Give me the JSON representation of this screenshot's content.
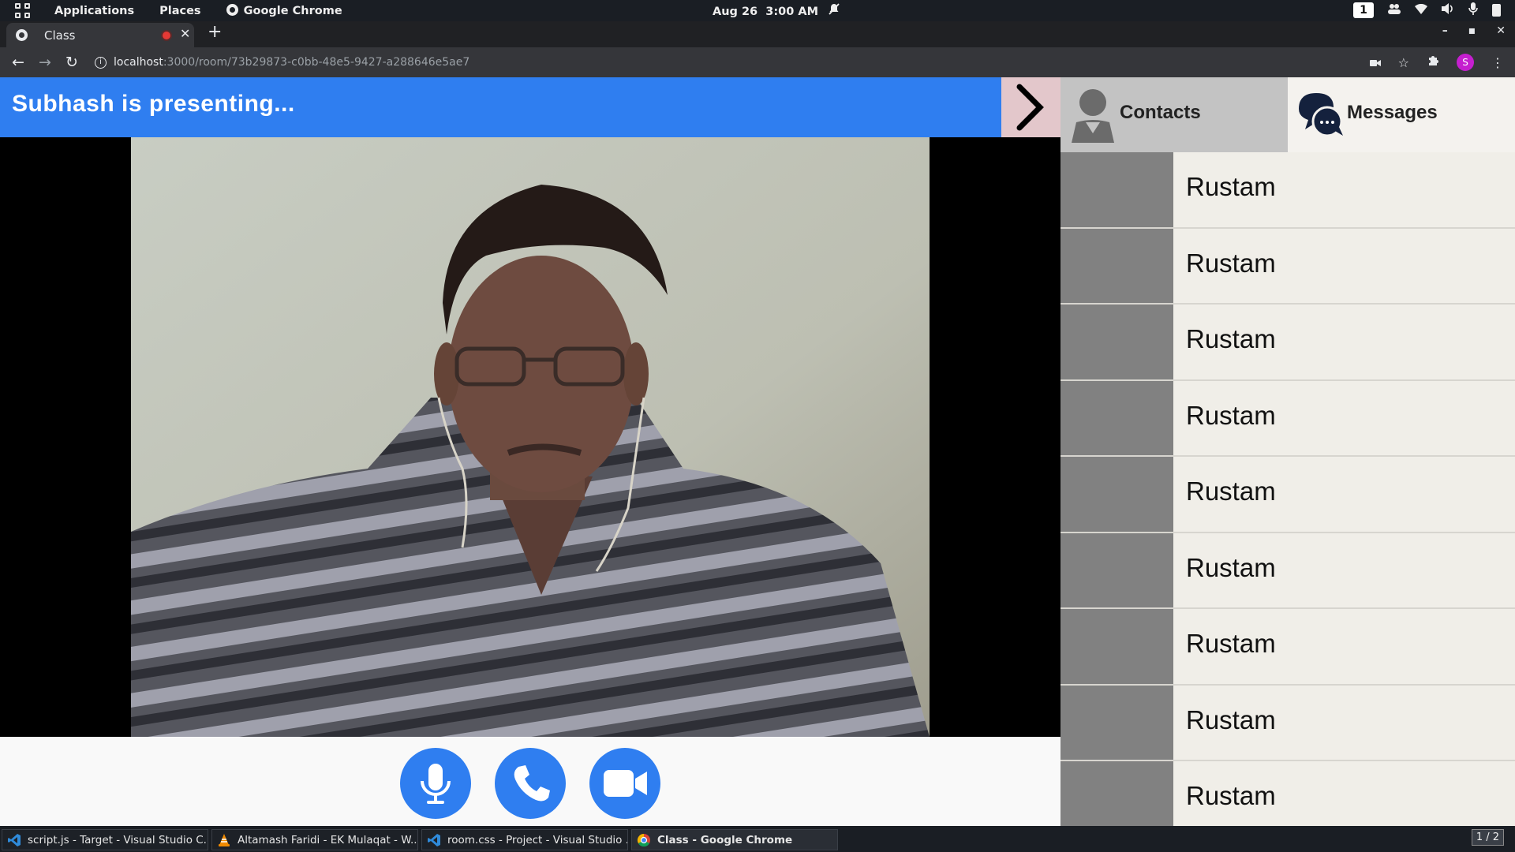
{
  "topbar": {
    "applications": "Applications",
    "places": "Places",
    "active_app": "Google Chrome",
    "date": "Aug 26",
    "time": "3:00 AM",
    "workspace": "1"
  },
  "browser": {
    "tab_title": "Class",
    "url_host": "localhost",
    "url_path": ":3000/room/73b29873-c0bb-48e5-9427-a288646e5ae7",
    "profile_initial": "S"
  },
  "meeting": {
    "presenter_text": "Subhash is presenting...",
    "accent_color": "#2f7ef0"
  },
  "sidebar": {
    "tabs": [
      {
        "label": "Contacts"
      },
      {
        "label": "Messages"
      }
    ],
    "contacts": [
      {
        "name": "Rustam"
      },
      {
        "name": "Rustam"
      },
      {
        "name": "Rustam"
      },
      {
        "name": "Rustam"
      },
      {
        "name": "Rustam"
      },
      {
        "name": "Rustam"
      },
      {
        "name": "Rustam"
      },
      {
        "name": "Rustam"
      },
      {
        "name": "Rustam"
      }
    ]
  },
  "taskbar": {
    "items": [
      {
        "label": "script.js - Target - Visual Studio C...",
        "icon": "vscode-icon"
      },
      {
        "label": "Altamash Faridi - EK Mulaqat - W...",
        "icon": "vlc-icon"
      },
      {
        "label": "room.css - Project - Visual Studio ...",
        "icon": "vscode-icon"
      },
      {
        "label": "Class - Google Chrome",
        "icon": "chrome-icon"
      }
    ],
    "pager": "1 / 2"
  }
}
